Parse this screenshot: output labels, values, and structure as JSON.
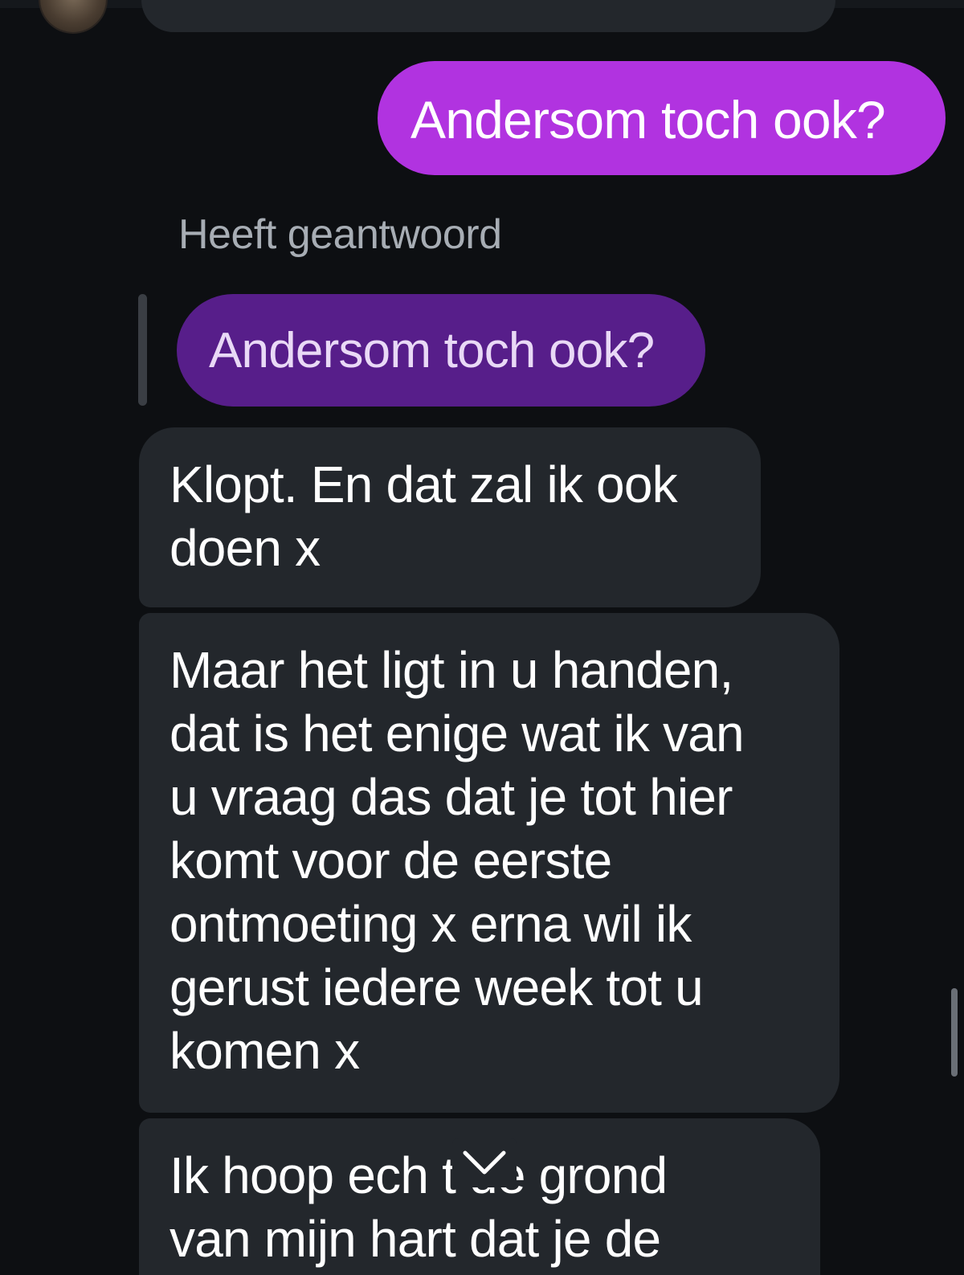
{
  "conversation": {
    "sent_message": "Andersom toch ook?",
    "reply_label": "Heeft geantwoord",
    "quoted_message": "Andersom toch ook?",
    "received_messages": [
      "Klopt. En dat zal ik ook\ndoen x",
      "Maar het ligt in u handen,\ndat is het enige wat ik van\nu vraag das dat je tot hier\nkomt voor de eerste\nontmoeting x erna wil ik\ngerust iedere week tot u\nkomen x",
      "Ik hoop ech      t de grond\nvan mijn hart dat je de"
    ]
  },
  "icons": {
    "jump_down": "chevron-down-icon",
    "avatar": "avatar"
  },
  "colors": {
    "background": "#0d0f12",
    "sent_bubble": "#b133e0",
    "quoted_bubble": "#571e8a",
    "received_bubble": "#23272c"
  }
}
